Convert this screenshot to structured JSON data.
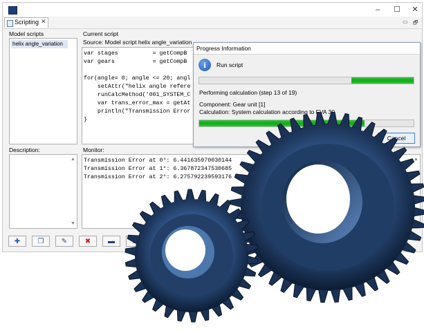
{
  "window": {
    "controls": {
      "minimize": "–",
      "maximize": "☐",
      "close": "✕"
    }
  },
  "tab": {
    "label": "Scripting",
    "close": "✕"
  },
  "view_buttons": {
    "minimize": "▭",
    "maximize": "🗗"
  },
  "model_scripts": {
    "label": "Model scripts",
    "items": [
      "helix angle_variation"
    ]
  },
  "description": {
    "label": "Description:"
  },
  "current_script": {
    "label": "Current script",
    "source": "Source: Model script helix angle_variation",
    "code_lines": [
      "var stages          = getCompB",
      "var gears           = getCompB",
      "",
      "for(angle= 0; angle <= 20; angl",
      "    setAttr(\"helix angle refere",
      "    runCalcMethod('001_SYSTEM_C",
      "    var trans_error_max = getAt",
      "    println(\"Transmission Error",
      "}"
    ]
  },
  "monitor": {
    "label": "Monitor:",
    "lines": [
      "Transmission Error at 0°: 6.441635970030144",
      "Transmission Error at 1°: 6.367872347530685",
      "Transmission Error at 2°: 6.275792239593176"
    ]
  },
  "toolbar": {
    "buttons": [
      {
        "name": "add",
        "glyph": "✚",
        "color": "#1f5fbf"
      },
      {
        "name": "copy",
        "glyph": "❐",
        "color": "#3a5a8a"
      },
      {
        "name": "edit",
        "glyph": "✎",
        "color": "#2a4a7a"
      },
      {
        "name": "delete",
        "glyph": "✖",
        "color": "#d01818"
      },
      {
        "name": "open",
        "glyph": "▬",
        "color": "#1f3f7a"
      },
      {
        "name": "export",
        "glyph": "⇲",
        "color": "#1f3f7a"
      }
    ]
  },
  "progress_dialog": {
    "title": "Progress Information",
    "run_label": "Run script",
    "progress_1": 0.29,
    "step_text": "Performing calculation (step 13 of 19)",
    "component_text": "Component: Gear unit [1]",
    "calculation_text": "Calculation: System calculation according to FVA 30",
    "progress_2": 0.77,
    "cancel_label": "Cancel",
    "accent_color": "#1fb126"
  }
}
